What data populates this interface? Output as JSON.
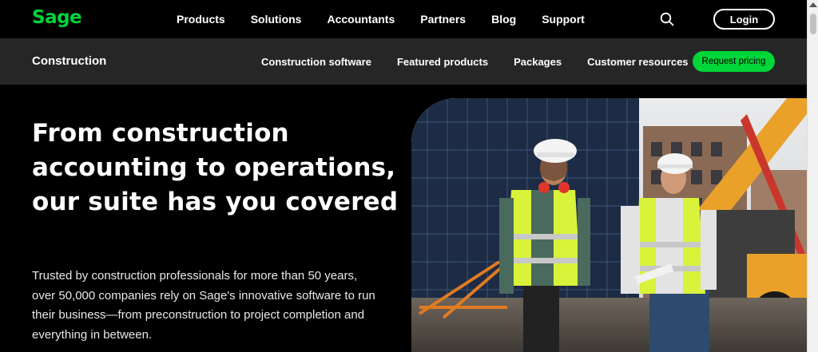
{
  "brand": {
    "logo_text": "Sage",
    "accent": "#00d639"
  },
  "top_nav": {
    "links": [
      "Products",
      "Solutions",
      "Accountants",
      "Partners",
      "Blog",
      "Support"
    ],
    "search_icon": "search-icon",
    "login_label": "Login"
  },
  "sub_nav": {
    "title": "Construction",
    "links": [
      "Construction software",
      "Featured products",
      "Packages",
      "Customer resources"
    ],
    "cta_label": "Request pricing"
  },
  "hero": {
    "title": "From construction accounting to operations, our suite has you covered",
    "description": "Trusted by construction professionals for more than 50 years, over 50,000 companies rely on Sage's innovative software to run their business—from preconstruction to project completion and everything in between."
  }
}
